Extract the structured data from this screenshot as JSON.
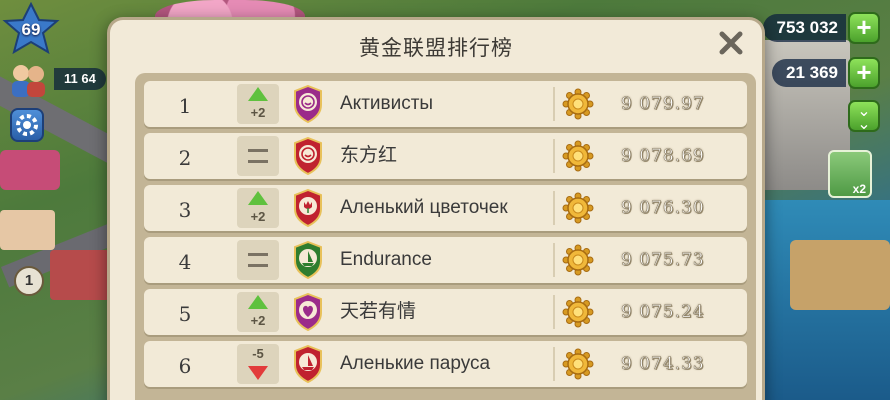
{
  "hud": {
    "level": "69",
    "coins_partial": "11 64",
    "resource_top": "753 032",
    "resource_second": "21 369",
    "multiplier": "x2",
    "side_badge": "1"
  },
  "modal": {
    "title": "黄金联盟排行榜"
  },
  "rows": [
    {
      "rank": "1",
      "change": "+2",
      "direction": "up",
      "emblem_color": "#9b2b8a",
      "emblem": "smile-emblem",
      "name": "Активисты",
      "score": "9 079.97"
    },
    {
      "rank": "2",
      "change": "",
      "direction": "same",
      "emblem_color": "#c0222f",
      "emblem": "smile-emblem",
      "name": "东方红",
      "score": "9 078.69"
    },
    {
      "rank": "3",
      "change": "+2",
      "direction": "up",
      "emblem_color": "#c0222f",
      "emblem": "tulip-emblem",
      "name": "Аленький цветочек",
      "score": "9 076.30"
    },
    {
      "rank": "4",
      "change": "",
      "direction": "same",
      "emblem_color": "#2f7d2f",
      "emblem": "boat-emblem",
      "name": "Endurance",
      "score": "9 075.73"
    },
    {
      "rank": "5",
      "change": "+2",
      "direction": "up",
      "emblem_color": "#9b2b8a",
      "emblem": "heart-emblem",
      "name": "天若有情",
      "score": "9 075.24"
    },
    {
      "rank": "6",
      "change": "-5",
      "direction": "down",
      "emblem_color": "#c0222f",
      "emblem": "boat-emblem",
      "name": "Аленькие паруса",
      "score": "9 074.33"
    }
  ]
}
